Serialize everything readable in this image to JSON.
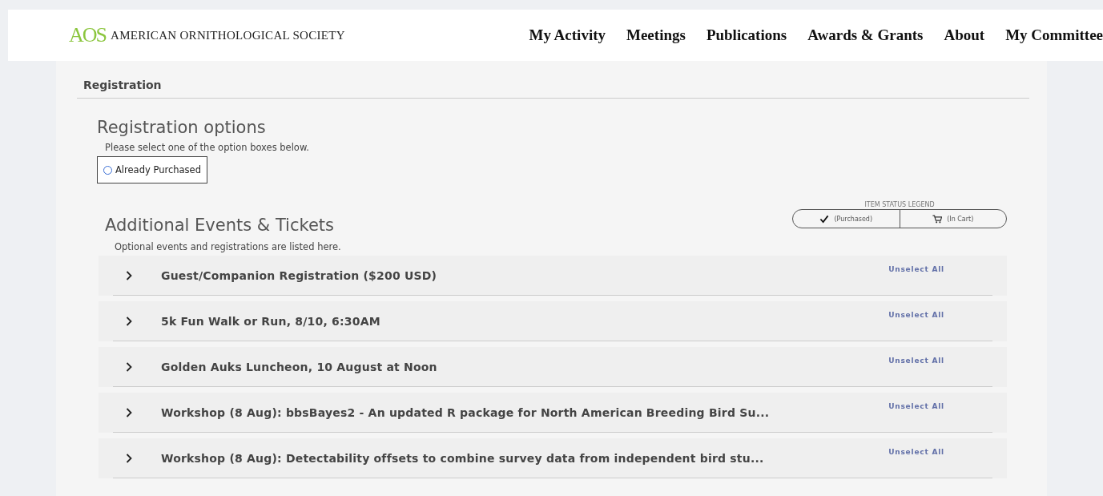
{
  "header": {
    "logo": "AOS",
    "org_name": "AMERICAN ORNITHOLOGICAL SOCIETY",
    "nav": [
      "My Activity",
      "Meetings",
      "Publications",
      "Awards & Grants",
      "About",
      "My Committee"
    ]
  },
  "breadcrumb": "Registration",
  "registration": {
    "title": "Registration options",
    "hint": "Please select one of the option boxes below.",
    "options": [
      {
        "label": "Already Purchased",
        "selected": false
      }
    ]
  },
  "legend": {
    "title": "ITEM STATUS LEGEND",
    "items": [
      {
        "kind": "check",
        "label": "(Purchased)"
      },
      {
        "kind": "cart",
        "label": "(In Cart)"
      }
    ]
  },
  "events": {
    "title": "Additional Events & Tickets",
    "hint": "Optional events and registrations are listed here.",
    "items": [
      {
        "title": "Guest/Companion Registration ($200 USD)",
        "action": "Unselect All",
        "expanded": false
      },
      {
        "title": "5k Fun Walk or Run, 8/10, 6:30AM",
        "action": "Unselect All",
        "expanded": false
      },
      {
        "title": "Golden Auks Luncheon, 10 August at Noon",
        "action": "Unselect All",
        "expanded": false
      },
      {
        "title": "Workshop (8 Aug): bbsBayes2 - An updated R package for North American Breeding Bird Su...",
        "action": "Unselect All",
        "expanded": false
      },
      {
        "title": "Workshop (8 Aug): Detectability offsets to combine survey data from independent bird stu...",
        "action": "Unselect All",
        "expanded": false
      }
    ]
  }
}
